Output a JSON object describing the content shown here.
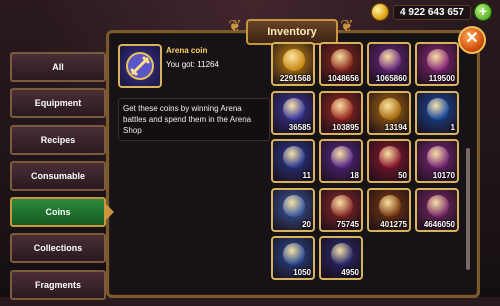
{
  "currency": {
    "icon": "gold-coin-icon",
    "value": "4 922 643 657"
  },
  "window": {
    "title": "Inventory"
  },
  "tabs": [
    {
      "label": "All",
      "active": false
    },
    {
      "label": "Equipment",
      "active": false
    },
    {
      "label": "Recipes",
      "active": false
    },
    {
      "label": "Consumable",
      "active": false
    },
    {
      "label": "Coins",
      "active": true
    },
    {
      "label": "Collections",
      "active": false
    },
    {
      "label": "Fragments",
      "active": false
    }
  ],
  "selected_item": {
    "name": "Arena coin",
    "quantity_label": "You got: 11264",
    "description": "Get these coins by winning Arena battles and spend them in the Arena Shop",
    "icon": "arena-coin-icon"
  },
  "items": [
    {
      "qty": "2291568",
      "color": "#c98a12",
      "icon": "gold-coin-icon"
    },
    {
      "qty": "1048656",
      "color": "#8a2a1e",
      "icon": "fire-coin-icon"
    },
    {
      "qty": "1065860",
      "color": "#6a2a80",
      "icon": "temple-coin-icon"
    },
    {
      "qty": "119500",
      "color": "#8a2a7a",
      "icon": "purple-orb-coin-icon"
    },
    {
      "qty": "36585",
      "color": "#3a3aa0",
      "icon": "gem-pile-icon"
    },
    {
      "qty": "103895",
      "color": "#9a2a20",
      "icon": "dragon-emblem-icon"
    },
    {
      "qty": "13194",
      "color": "#a86a10",
      "icon": "guild-coin-icon"
    },
    {
      "qty": "1",
      "color": "#1a4aa0",
      "icon": "ticket-icon"
    },
    {
      "qty": "11",
      "color": "#2a3a90",
      "icon": "compass-icon"
    },
    {
      "qty": "18",
      "color": "#5a2a8a",
      "icon": "arena-coin-icon"
    },
    {
      "qty": "50",
      "color": "#8a1a30",
      "icon": "red-orb-icon"
    },
    {
      "qty": "10170",
      "color": "#7a2a7a",
      "icon": "crystal-icon"
    },
    {
      "qty": "20",
      "color": "#3a5aa0",
      "icon": "scroll-icon"
    },
    {
      "qty": "75745",
      "color": "#8a2a2a",
      "icon": "rune-coin-icon"
    },
    {
      "qty": "401275",
      "color": "#7a3a10",
      "icon": "ember-coin-icon"
    },
    {
      "qty": "4646050",
      "color": "#7a2a6a",
      "icon": "magenta-gem-icon"
    },
    {
      "qty": "1050",
      "color": "#2a4a90",
      "icon": "portal-coin-icon"
    },
    {
      "qty": "4950",
      "color": "#2a2a70",
      "icon": "amulet-icon"
    }
  ],
  "close": {
    "icon": "close-icon"
  },
  "add": {
    "icon": "plus-icon"
  }
}
